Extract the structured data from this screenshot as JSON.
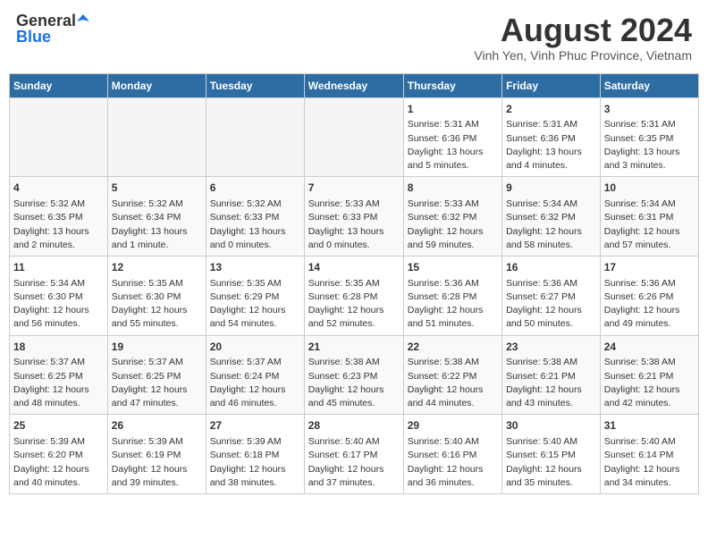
{
  "header": {
    "logo_general": "General",
    "logo_blue": "Blue",
    "month_title": "August 2024",
    "location": "Vinh Yen, Vinh Phuc Province, Vietnam"
  },
  "weekdays": [
    "Sunday",
    "Monday",
    "Tuesday",
    "Wednesday",
    "Thursday",
    "Friday",
    "Saturday"
  ],
  "weeks": [
    [
      {
        "day": "",
        "info": ""
      },
      {
        "day": "",
        "info": ""
      },
      {
        "day": "",
        "info": ""
      },
      {
        "day": "",
        "info": ""
      },
      {
        "day": "1",
        "info": "Sunrise: 5:31 AM\nSunset: 6:36 PM\nDaylight: 13 hours\nand 5 minutes."
      },
      {
        "day": "2",
        "info": "Sunrise: 5:31 AM\nSunset: 6:36 PM\nDaylight: 13 hours\nand 4 minutes."
      },
      {
        "day": "3",
        "info": "Sunrise: 5:31 AM\nSunset: 6:35 PM\nDaylight: 13 hours\nand 3 minutes."
      }
    ],
    [
      {
        "day": "4",
        "info": "Sunrise: 5:32 AM\nSunset: 6:35 PM\nDaylight: 13 hours\nand 2 minutes."
      },
      {
        "day": "5",
        "info": "Sunrise: 5:32 AM\nSunset: 6:34 PM\nDaylight: 13 hours\nand 1 minute."
      },
      {
        "day": "6",
        "info": "Sunrise: 5:32 AM\nSunset: 6:33 PM\nDaylight: 13 hours\nand 0 minutes."
      },
      {
        "day": "7",
        "info": "Sunrise: 5:33 AM\nSunset: 6:33 PM\nDaylight: 13 hours\nand 0 minutes."
      },
      {
        "day": "8",
        "info": "Sunrise: 5:33 AM\nSunset: 6:32 PM\nDaylight: 12 hours\nand 59 minutes."
      },
      {
        "day": "9",
        "info": "Sunrise: 5:34 AM\nSunset: 6:32 PM\nDaylight: 12 hours\nand 58 minutes."
      },
      {
        "day": "10",
        "info": "Sunrise: 5:34 AM\nSunset: 6:31 PM\nDaylight: 12 hours\nand 57 minutes."
      }
    ],
    [
      {
        "day": "11",
        "info": "Sunrise: 5:34 AM\nSunset: 6:30 PM\nDaylight: 12 hours\nand 56 minutes."
      },
      {
        "day": "12",
        "info": "Sunrise: 5:35 AM\nSunset: 6:30 PM\nDaylight: 12 hours\nand 55 minutes."
      },
      {
        "day": "13",
        "info": "Sunrise: 5:35 AM\nSunset: 6:29 PM\nDaylight: 12 hours\nand 54 minutes."
      },
      {
        "day": "14",
        "info": "Sunrise: 5:35 AM\nSunset: 6:28 PM\nDaylight: 12 hours\nand 52 minutes."
      },
      {
        "day": "15",
        "info": "Sunrise: 5:36 AM\nSunset: 6:28 PM\nDaylight: 12 hours\nand 51 minutes."
      },
      {
        "day": "16",
        "info": "Sunrise: 5:36 AM\nSunset: 6:27 PM\nDaylight: 12 hours\nand 50 minutes."
      },
      {
        "day": "17",
        "info": "Sunrise: 5:36 AM\nSunset: 6:26 PM\nDaylight: 12 hours\nand 49 minutes."
      }
    ],
    [
      {
        "day": "18",
        "info": "Sunrise: 5:37 AM\nSunset: 6:25 PM\nDaylight: 12 hours\nand 48 minutes."
      },
      {
        "day": "19",
        "info": "Sunrise: 5:37 AM\nSunset: 6:25 PM\nDaylight: 12 hours\nand 47 minutes."
      },
      {
        "day": "20",
        "info": "Sunrise: 5:37 AM\nSunset: 6:24 PM\nDaylight: 12 hours\nand 46 minutes."
      },
      {
        "day": "21",
        "info": "Sunrise: 5:38 AM\nSunset: 6:23 PM\nDaylight: 12 hours\nand 45 minutes."
      },
      {
        "day": "22",
        "info": "Sunrise: 5:38 AM\nSunset: 6:22 PM\nDaylight: 12 hours\nand 44 minutes."
      },
      {
        "day": "23",
        "info": "Sunrise: 5:38 AM\nSunset: 6:21 PM\nDaylight: 12 hours\nand 43 minutes."
      },
      {
        "day": "24",
        "info": "Sunrise: 5:38 AM\nSunset: 6:21 PM\nDaylight: 12 hours\nand 42 minutes."
      }
    ],
    [
      {
        "day": "25",
        "info": "Sunrise: 5:39 AM\nSunset: 6:20 PM\nDaylight: 12 hours\nand 40 minutes."
      },
      {
        "day": "26",
        "info": "Sunrise: 5:39 AM\nSunset: 6:19 PM\nDaylight: 12 hours\nand 39 minutes."
      },
      {
        "day": "27",
        "info": "Sunrise: 5:39 AM\nSunset: 6:18 PM\nDaylight: 12 hours\nand 38 minutes."
      },
      {
        "day": "28",
        "info": "Sunrise: 5:40 AM\nSunset: 6:17 PM\nDaylight: 12 hours\nand 37 minutes."
      },
      {
        "day": "29",
        "info": "Sunrise: 5:40 AM\nSunset: 6:16 PM\nDaylight: 12 hours\nand 36 minutes."
      },
      {
        "day": "30",
        "info": "Sunrise: 5:40 AM\nSunset: 6:15 PM\nDaylight: 12 hours\nand 35 minutes."
      },
      {
        "day": "31",
        "info": "Sunrise: 5:40 AM\nSunset: 6:14 PM\nDaylight: 12 hours\nand 34 minutes."
      }
    ]
  ]
}
